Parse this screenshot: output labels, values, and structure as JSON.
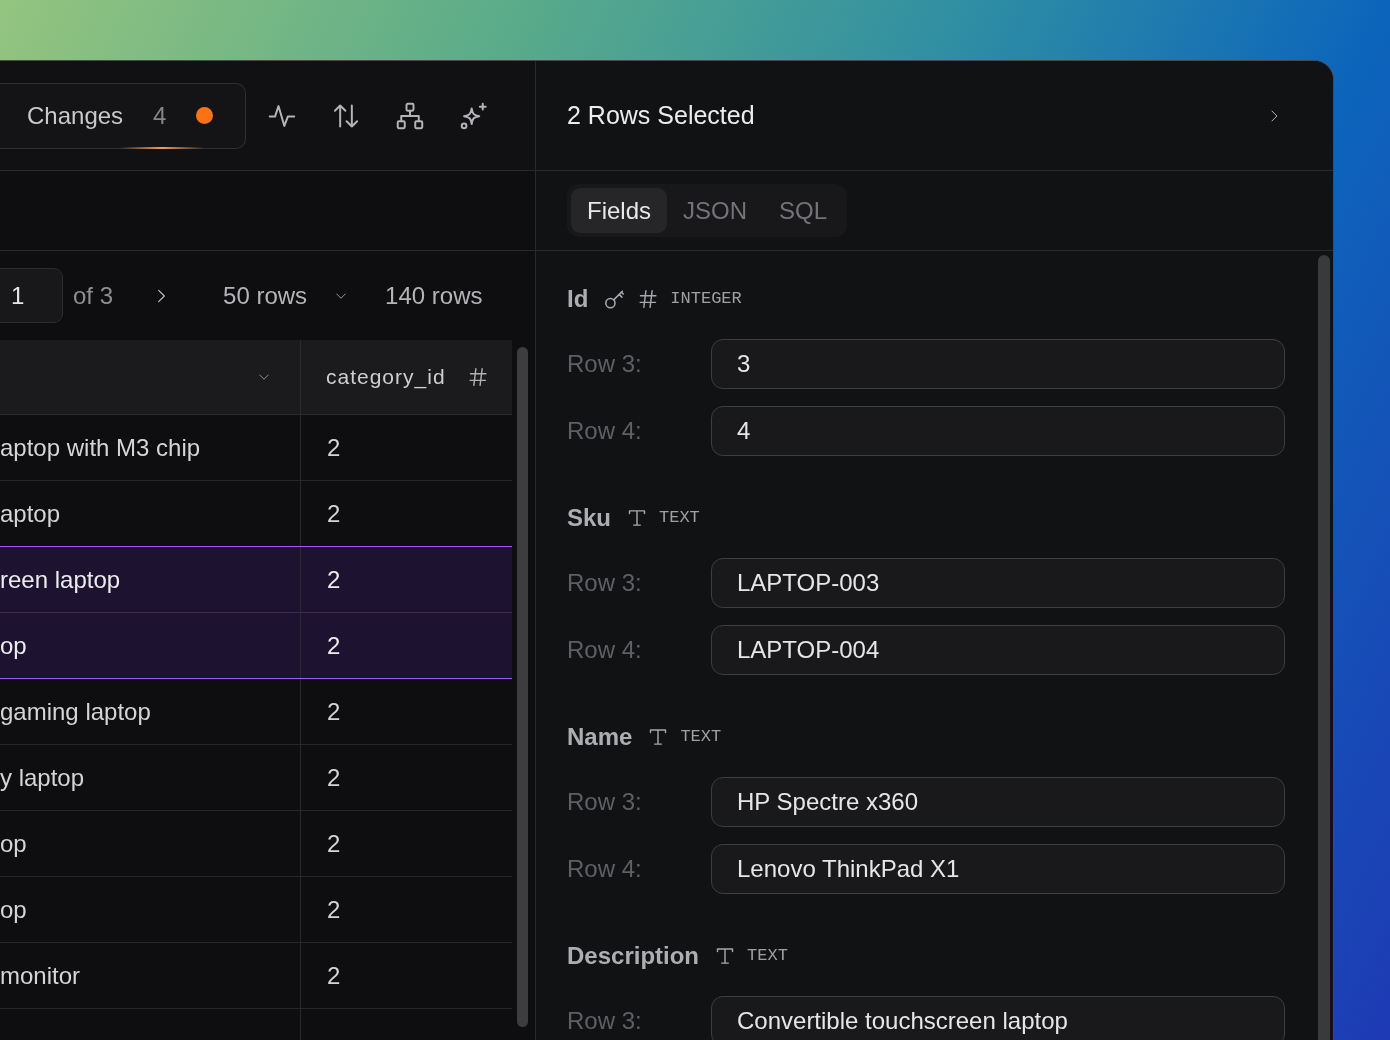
{
  "toolbar": {
    "changes": {
      "label": "Changes",
      "count": "4",
      "unsaved": true
    }
  },
  "pagination": {
    "page": "1",
    "page_count": "of 3",
    "page_size": "50 rows",
    "total": "140 rows"
  },
  "table": {
    "columns": [
      {
        "kind": "menu"
      },
      {
        "kind": "number",
        "label": "category_id"
      }
    ],
    "rows": [
      {
        "cells": [
          "aptop with M3 chip",
          "2"
        ],
        "selected": false
      },
      {
        "cells": [
          "aptop",
          "2"
        ],
        "selected": false
      },
      {
        "cells": [
          "reen laptop",
          "2"
        ],
        "selected": true
      },
      {
        "cells": [
          "op",
          "2"
        ],
        "selected": true
      },
      {
        "cells": [
          "gaming laptop",
          "2"
        ],
        "selected": false
      },
      {
        "cells": [
          "y laptop",
          "2"
        ],
        "selected": false
      },
      {
        "cells": [
          "op",
          "2"
        ],
        "selected": false
      },
      {
        "cells": [
          "op",
          "2"
        ],
        "selected": false
      },
      {
        "cells": [
          "monitor",
          "2"
        ],
        "selected": false
      }
    ]
  },
  "details": {
    "title": "2 Rows Selected",
    "tabs": [
      {
        "label": "Fields",
        "selected": true
      },
      {
        "label": "JSON",
        "selected": false
      },
      {
        "label": "SQL",
        "selected": false
      }
    ],
    "fields": [
      {
        "name": "Id",
        "kind": "integer",
        "type": "INTEGER",
        "primary_key": true,
        "values": [
          {
            "label": "Row 3:",
            "value": "3"
          },
          {
            "label": "Row 4:",
            "value": "4"
          }
        ]
      },
      {
        "name": "Sku",
        "kind": "text",
        "type": "TEXT",
        "primary_key": false,
        "values": [
          {
            "label": "Row 3:",
            "value": "LAPTOP-003"
          },
          {
            "label": "Row 4:",
            "value": "LAPTOP-004"
          }
        ]
      },
      {
        "name": "Name",
        "kind": "text",
        "type": "TEXT",
        "primary_key": false,
        "values": [
          {
            "label": "Row 3:",
            "value": "HP Spectre x360"
          },
          {
            "label": "Row 4:",
            "value": "Lenovo ThinkPad X1"
          }
        ]
      },
      {
        "name": "Description",
        "kind": "text",
        "type": "TEXT",
        "primary_key": false,
        "values": [
          {
            "label": "Row 3:",
            "value": "Convertible touchscreen laptop"
          }
        ]
      }
    ]
  }
}
